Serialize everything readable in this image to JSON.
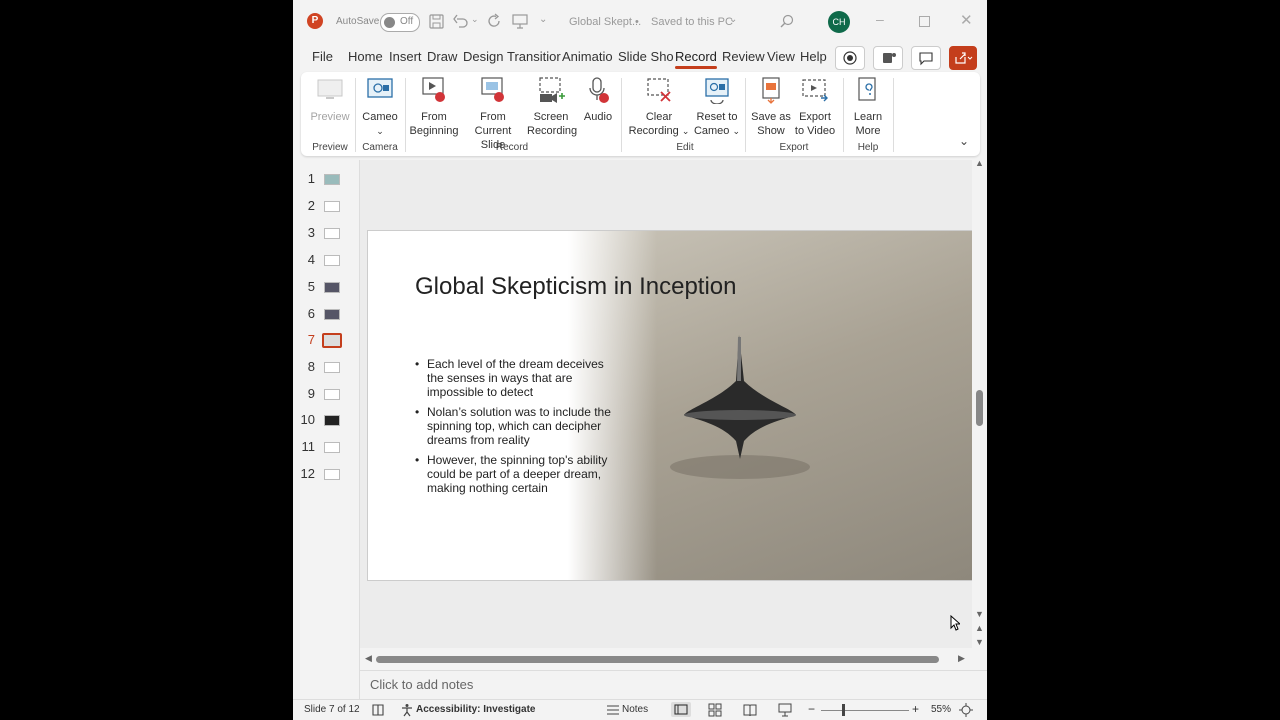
{
  "titlebar": {
    "autosave_label": "AutoSave",
    "autosave_state": "Off",
    "doc_title": "Global Skept...",
    "saved_status": "Saved to this PC",
    "avatar_initials": "CH"
  },
  "tabs": [
    "File",
    "Home",
    "Insert",
    "Draw",
    "Design",
    "Transitior",
    "Animatio",
    "Slide Sho",
    "Record",
    "Review",
    "View",
    "Help"
  ],
  "active_tab": "Record",
  "ribbon": {
    "preview": {
      "label": "Preview",
      "group": "Preview"
    },
    "cameo": {
      "label": "Cameo",
      "group": "Camera"
    },
    "from_beginning": {
      "line1": "From",
      "line2": "Beginning"
    },
    "from_current": {
      "line1": "From",
      "line2": "Current Slide"
    },
    "screen_recording": {
      "line1": "Screen",
      "line2": "Recording"
    },
    "audio": {
      "label": "Audio"
    },
    "record_group": "Record",
    "clear_recording": {
      "line1": "Clear",
      "line2": "Recording"
    },
    "reset_to_cameo": {
      "line1": "Reset to",
      "line2": "Cameo"
    },
    "edit_group": "Edit",
    "save_as_show": {
      "line1": "Save as",
      "line2": "Show"
    },
    "export_to_video": {
      "line1": "Export",
      "line2": "to Video"
    },
    "export_group": "Export",
    "learn_more": {
      "line1": "Learn",
      "line2": "More"
    },
    "help_group": "Help"
  },
  "thumbnails": {
    "numbers": [
      "1",
      "2",
      "3",
      "4",
      "5",
      "6",
      "7",
      "8",
      "9",
      "10",
      "11",
      "12"
    ],
    "selected": "7"
  },
  "slide": {
    "title": "Global Skepticism in Inception",
    "bullets": [
      "Each level of the dream deceives the senses in ways that are impossible to detect",
      "Nolan’s solution was to include the spinning top, which can decipher dreams from reality",
      "However, the spinning top's ability could be part of a deeper dream, making nothing certain"
    ]
  },
  "notes_placeholder": "Click to add notes",
  "status": {
    "slide_counter": "Slide 7 of 12",
    "accessibility": "Accessibility: Investigate",
    "notes_label": "Notes",
    "zoom": "55%"
  },
  "colors": {
    "accent": "#c43e1c",
    "avatar": "#0f6a4a"
  }
}
